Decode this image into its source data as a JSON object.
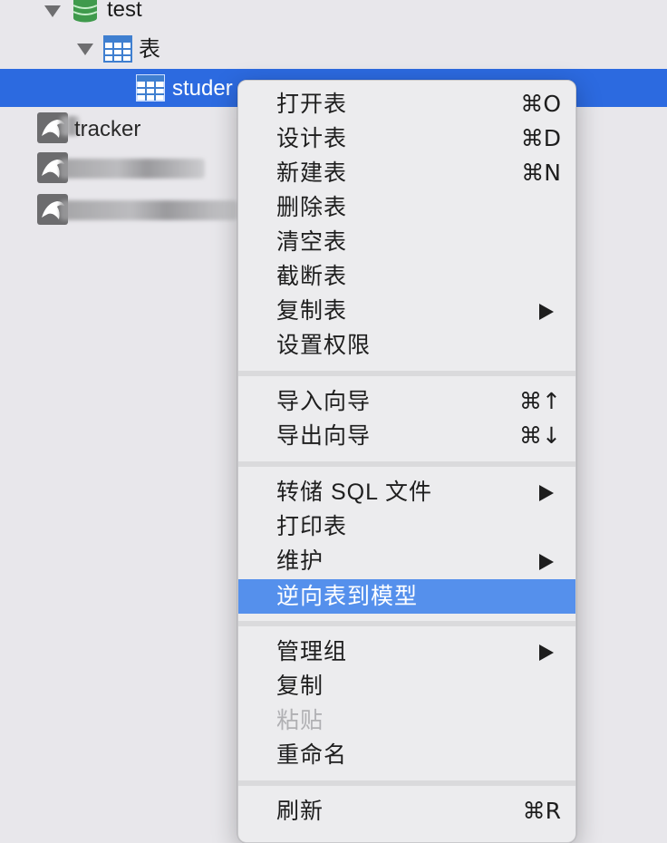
{
  "tree": {
    "database": {
      "label": "test",
      "icon": "database-icon"
    },
    "tables_folder": {
      "label": "表",
      "icon": "table-icon"
    },
    "selected_table": {
      "label": "studer",
      "icon": "table-icon"
    },
    "connections": [
      {
        "label": "tracker",
        "icon": "mysql-dolphin-icon",
        "redacted": false
      },
      {
        "label": "",
        "icon": "mysql-dolphin-icon",
        "redacted": true
      },
      {
        "label": "",
        "icon": "mysql-dolphin-icon",
        "redacted": true
      }
    ]
  },
  "menu": {
    "items": [
      {
        "label": "打开表",
        "shortcut": "⌘O"
      },
      {
        "label": "设计表",
        "shortcut": "⌘D"
      },
      {
        "label": "新建表",
        "shortcut": "⌘N"
      },
      {
        "label": "删除表"
      },
      {
        "label": "清空表"
      },
      {
        "label": "截断表"
      },
      {
        "label": "复制表",
        "submenu": true
      },
      {
        "label": "设置权限"
      },
      {
        "label": "导入向导",
        "shortcut": "⌘↑"
      },
      {
        "label": "导出向导",
        "shortcut": "⌘↓"
      },
      {
        "label": "转储 SQL 文件",
        "submenu": true
      },
      {
        "label": "打印表"
      },
      {
        "label": "维护",
        "submenu": true
      },
      {
        "label": "逆向表到模型",
        "highlighted": true
      },
      {
        "label": "管理组",
        "submenu": true
      },
      {
        "label": "复制"
      },
      {
        "label": "粘贴",
        "disabled": true
      },
      {
        "label": "重命名"
      },
      {
        "label": "刷新",
        "shortcut": "⌘R"
      }
    ]
  },
  "colors": {
    "selection": "#2c6ae0",
    "menu_highlight": "#5590ec",
    "db_green": "#3f9a4c",
    "table_blue": "#3f7fd0"
  }
}
